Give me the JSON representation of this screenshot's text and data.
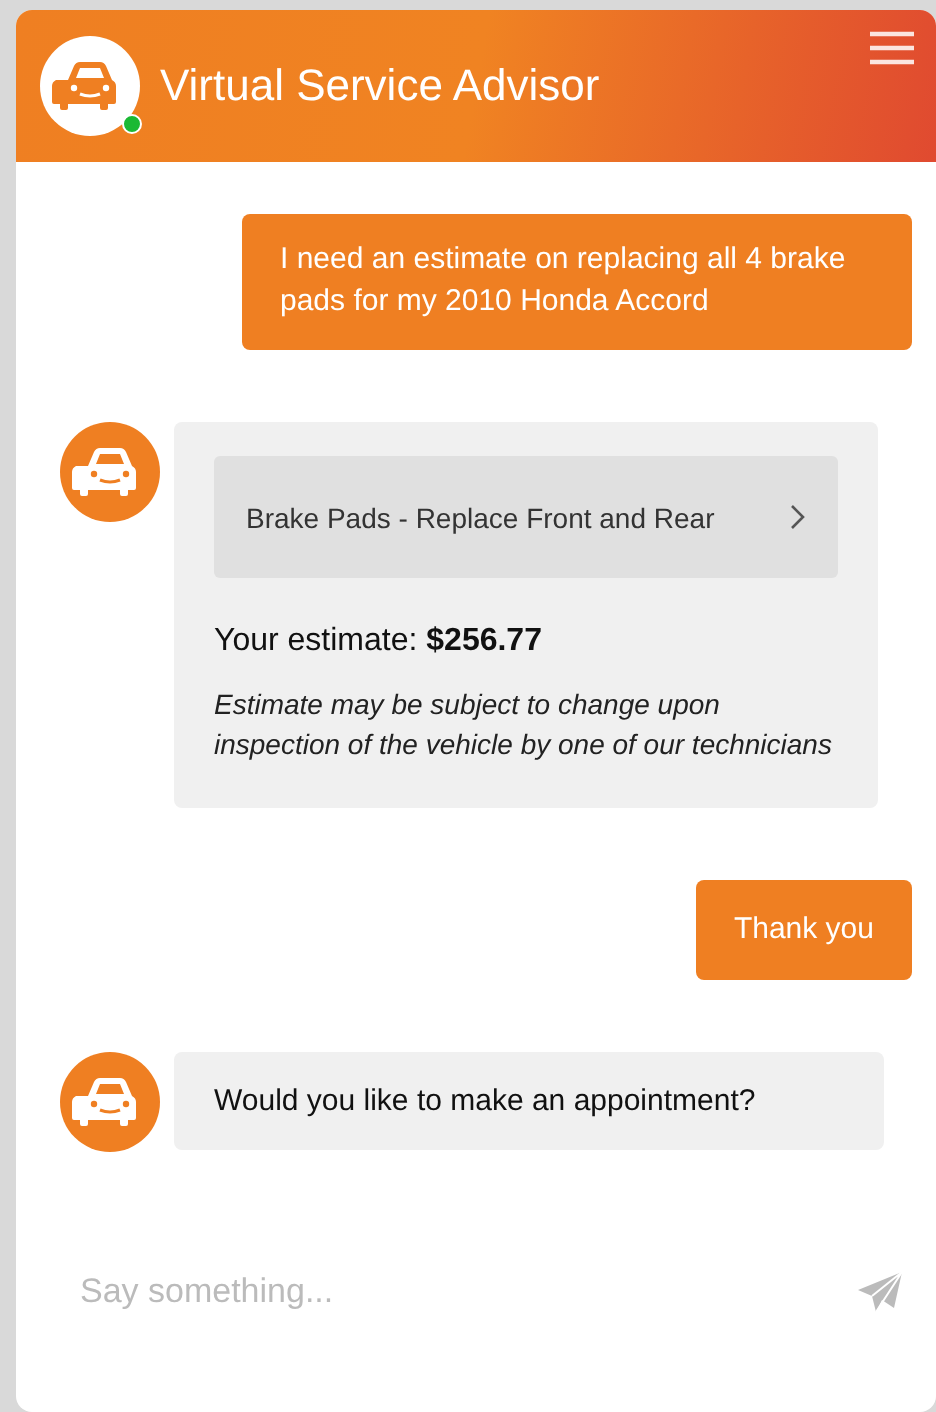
{
  "header": {
    "title": "Virtual Service Advisor",
    "online": true
  },
  "messages": [
    {
      "kind": "user",
      "text": "I need an estimate on replacing all 4 brake pads for my 2010 Honda Accord"
    },
    {
      "kind": "estimate",
      "service": "Brake Pads - Replace Front and Rear",
      "estimate": "Your estimate: **$256.77**",
      "note": "Estimate may be subject to change upon inspection of the vehicle by one of our technicians"
    },
    {
      "kind": "user",
      "text": "Thank you"
    },
    {
      "kind": "bot",
      "text": "Would you like to make an appointment?"
    }
  ],
  "composer": {
    "placeholder": "Say something..."
  }
}
